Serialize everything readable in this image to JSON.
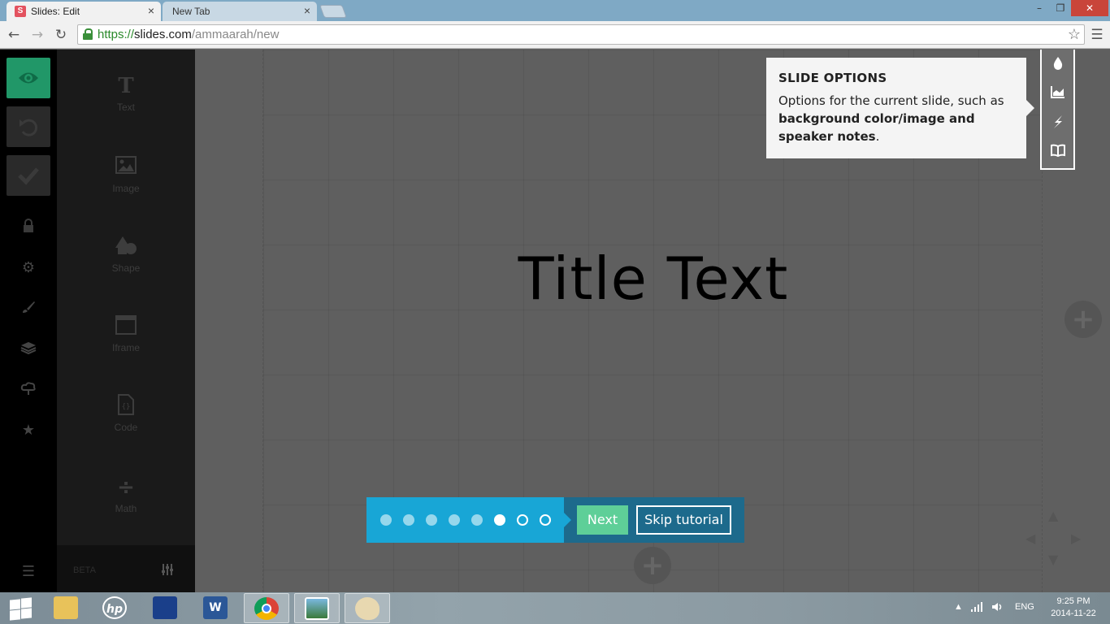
{
  "browser": {
    "tabs": [
      {
        "label": "Slides: Edit",
        "favicon": "S",
        "active": true
      },
      {
        "label": "New Tab",
        "active": false
      }
    ],
    "close_glyph": "×",
    "url": {
      "scheme": "https://",
      "host": "slides.com",
      "path": "/ammaarah/new"
    },
    "window": {
      "minimize": "–",
      "maximize": "❐",
      "close": "✕"
    }
  },
  "rail": {
    "buttons": [
      {
        "name": "preview",
        "icon": "eye-icon"
      },
      {
        "name": "undo",
        "icon": "undo-icon"
      },
      {
        "name": "save",
        "icon": "check-icon"
      }
    ],
    "icons": [
      "lock-icon",
      "gear-icon",
      "brush-icon",
      "layers-icon",
      "cloud-icon",
      "star-icon"
    ],
    "menu_icon": "hamburger-icon"
  },
  "elements": {
    "items": [
      {
        "label": "Text",
        "icon": "text-icon"
      },
      {
        "label": "Image",
        "icon": "image-icon"
      },
      {
        "label": "Shape",
        "icon": "shape-icon"
      },
      {
        "label": "Iframe",
        "icon": "iframe-icon"
      },
      {
        "label": "Code",
        "icon": "code-icon"
      },
      {
        "label": "Math",
        "icon": "math-icon"
      }
    ],
    "beta_label": "BETA"
  },
  "slide": {
    "title": "Title Text",
    "accent": "#219768"
  },
  "slide_options": {
    "icons": [
      "drop-icon",
      "chart-icon",
      "lightning-icon",
      "book-icon"
    ]
  },
  "tooltip": {
    "heading": "SLIDE OPTIONS",
    "text_before": "Options for the current slide, such as ",
    "text_bold": "background color/image and speaker notes",
    "text_after": "."
  },
  "tutorial": {
    "total_steps": 8,
    "current_step": 6,
    "next_label": "Next",
    "skip_label": "Skip tutorial",
    "colors": {
      "dots_bg": "#18a6d6",
      "bar_bg": "#1d6a8c",
      "next_bg": "#5ecf98"
    }
  },
  "taskbar": {
    "apps": [
      {
        "name": "file-explorer",
        "icon": "folder-icon"
      },
      {
        "name": "hp",
        "icon": "hp-icon"
      },
      {
        "name": "paint-app",
        "icon": "picture-icon"
      },
      {
        "name": "word",
        "icon": "word-icon"
      },
      {
        "name": "chrome",
        "icon": "chrome-icon",
        "running": true
      },
      {
        "name": "photos",
        "icon": "photo-viewer-icon"
      },
      {
        "name": "paint",
        "icon": "palette-icon"
      }
    ],
    "tray_lang": "ENG",
    "time": "9:25 PM",
    "date": "2014-11-22"
  }
}
